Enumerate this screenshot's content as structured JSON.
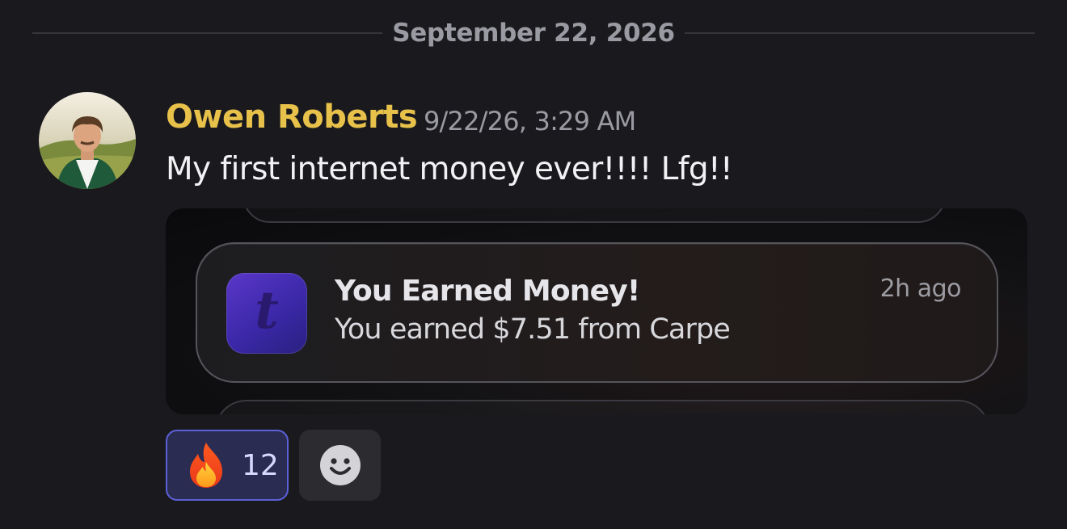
{
  "divider": {
    "date": "September 22, 2026"
  },
  "message": {
    "author": "Owen Roberts",
    "author_color": "#e8c14a",
    "timestamp": "9/22/26, 3:29 AM",
    "text": "My first internet money ever!!!! Lfg!!",
    "avatar_icon": "user-avatar-photo"
  },
  "embed": {
    "notification": {
      "app_icon": "tip-app-icon",
      "app_icon_letter": "t",
      "title": "You Earned Money!",
      "body": "You earned $7.51 from Carpe",
      "time": "2h ago"
    }
  },
  "reactions": [
    {
      "emoji": "fire-emoji",
      "count": "12",
      "active": true
    }
  ],
  "add_reaction": {
    "icon": "smiley-icon"
  },
  "colors": {
    "background": "#1a1a1e",
    "reaction_border": "#5b61d8",
    "reaction_bg": "#2a2c52"
  }
}
